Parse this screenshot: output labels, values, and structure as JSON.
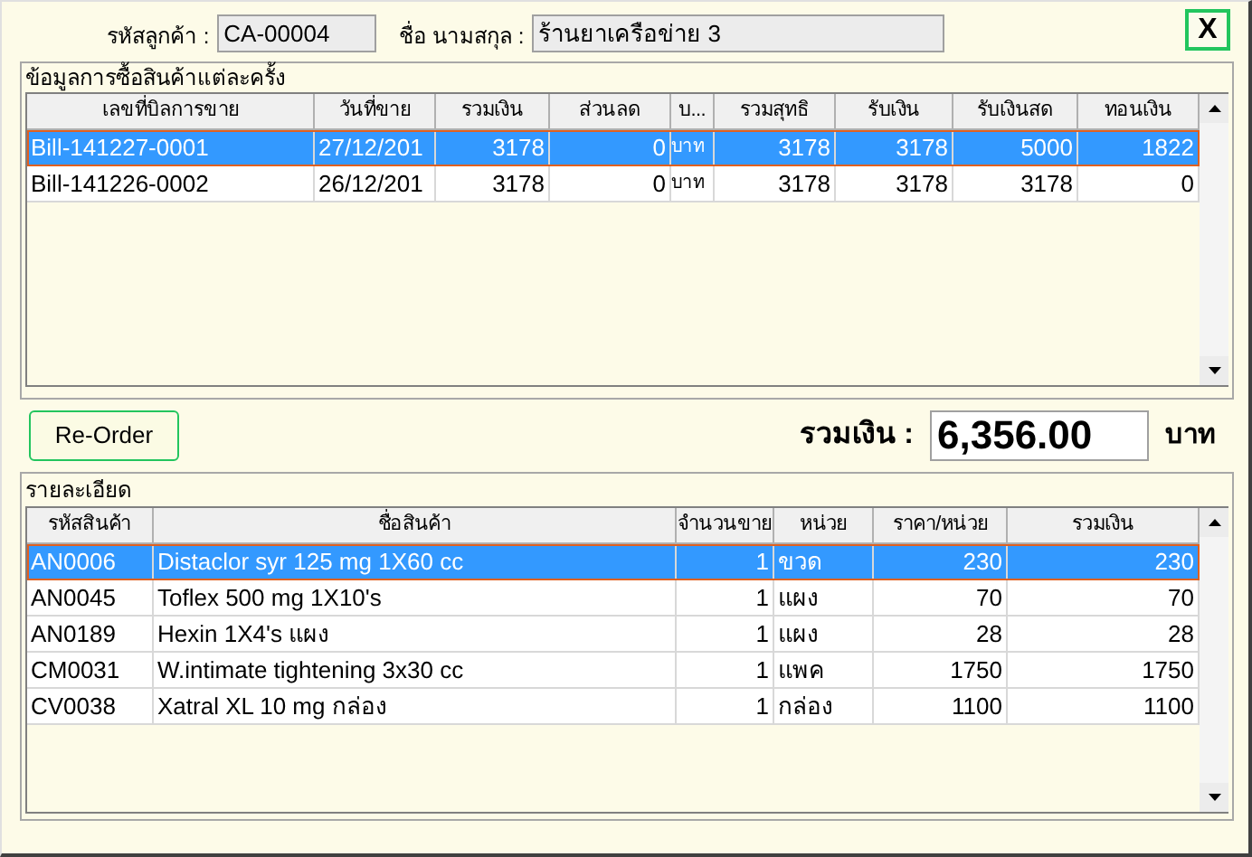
{
  "header": {
    "customer_code_label": "รหัสลูกค้า :",
    "customer_code": "CA-00004",
    "name_label": "ชื่อ นามสกุล :",
    "name": "ร้านยาเครือข่าย 3",
    "close": "X"
  },
  "bills": {
    "title": "ข้อมูลการซื้อสินค้าแต่ละครั้ง",
    "columns": [
      "เลขที่บิลการขาย",
      "วันที่ขาย",
      "รวมเงิน",
      "ส่วนลด",
      "บ...",
      "รวมสุทธิ",
      "รับเงิน",
      "รับเงินสด",
      "ทอนเงิน"
    ],
    "rows": [
      {
        "selected": true,
        "cells": [
          "Bill-141227-0001",
          "27/12/201",
          "3178",
          "0",
          "บาท",
          "3178",
          "3178",
          "5000",
          "1822"
        ]
      },
      {
        "selected": false,
        "cells": [
          "Bill-141226-0002",
          "26/12/201",
          "3178",
          "0",
          "บาท",
          "3178",
          "3178",
          "3178",
          "0"
        ]
      }
    ]
  },
  "reorder": "Re-Order",
  "total_label": "รวมเงิน :",
  "total": "6,356.00",
  "currency": "บาท",
  "details": {
    "title": "รายละเอียด",
    "columns": [
      "รหัสสินค้า",
      "ชื่อสินค้า",
      "จำนวนขาย",
      "หน่วย",
      "ราคา/หน่วย",
      "รวมเงิน"
    ],
    "rows": [
      {
        "selected": true,
        "cells": [
          "AN0006",
          "Distaclor syr 125 mg 1X60 cc",
          "1",
          "ขวด",
          "230",
          "230"
        ]
      },
      {
        "selected": false,
        "cells": [
          "AN0045",
          "Toflex 500 mg 1X10's",
          "1",
          "แผง",
          "70",
          "70"
        ]
      },
      {
        "selected": false,
        "cells": [
          "AN0189",
          "Hexin 1X4's แผง",
          "1",
          "แผง",
          "28",
          "28"
        ]
      },
      {
        "selected": false,
        "cells": [
          "CM0031",
          "W.intimate tightening 3x30 cc",
          "1",
          "แพค",
          "1750",
          "1750"
        ]
      },
      {
        "selected": false,
        "cells": [
          "CV0038",
          "Xatral XL 10 mg กล่อง",
          "1",
          "กล่อง",
          "1100",
          "1100"
        ]
      }
    ]
  }
}
